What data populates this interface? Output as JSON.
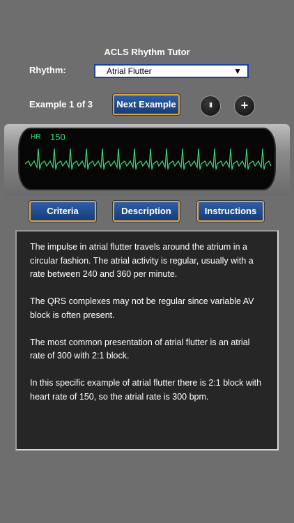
{
  "app": {
    "title": "ACLS Rhythm Tutor"
  },
  "rhythm": {
    "label": "Rhythm:",
    "selected": "Atrial Flutter",
    "arrow_icon": "▼"
  },
  "example": {
    "label": "Example 1 of 3",
    "next_label": "Next Example"
  },
  "controls": {
    "pause_icon": "II",
    "plus_icon": "+"
  },
  "monitor": {
    "hr_label": "HR",
    "hr_value": "150",
    "trace_color": "#2fe07a"
  },
  "tabs": {
    "criteria": "Criteria",
    "description": "Description",
    "instructions": "Instructions"
  },
  "content": {
    "paragraphs": [
      "The impulse in atrial flutter travels around the atrium in a circular fashion. The atrial activity is regular, usually with a rate between 240 and 360 per minute.",
      "The QRS complexes may not be regular since variable AV block is often present.",
      "The most common presentation of atrial flutter is an atrial rate of 300 with 2:1 block.",
      "In this specific example of atrial flutter there is 2:1 block with heart rate of 150, so the atrial rate is 300 bpm."
    ]
  },
  "colors": {
    "button_fill": "#1f4a8e",
    "button_border": "#e5a33b",
    "panel_bg": "#262626",
    "page_bg": "#6e6e6e"
  }
}
